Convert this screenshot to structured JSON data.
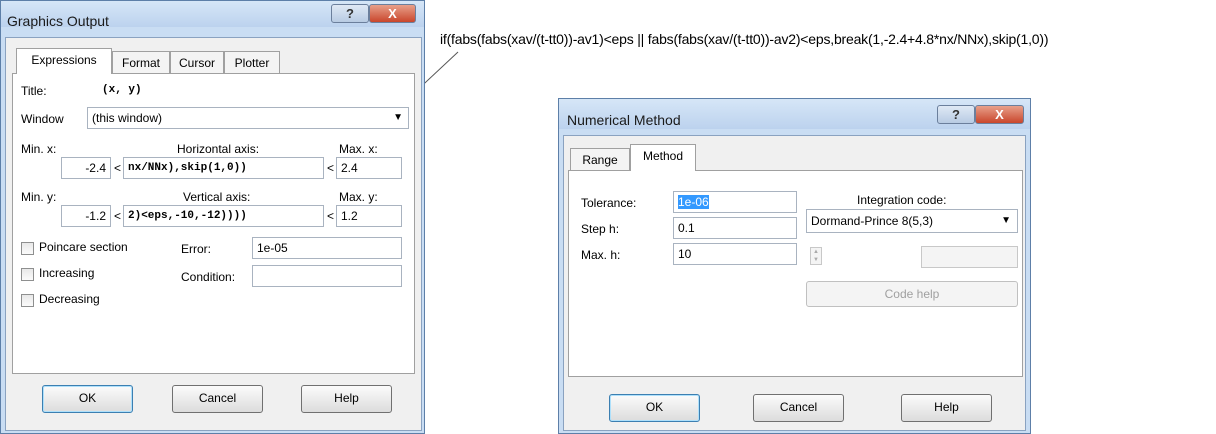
{
  "annotation": {
    "expression": "if(fabs(fabs(xav/(t-tt0))-av1)<eps || fabs(fabs(xav/(t-tt0))-av2)<eps,break(1,-2.4+4.8*nx/NNx),skip(1,0))"
  },
  "graphics": {
    "title": "Graphics Output",
    "help_btn": "?",
    "close_btn": "X",
    "tabs": [
      "Expressions",
      "Format",
      "Cursor",
      "Plotter"
    ],
    "title_label": "Title:",
    "title_value": "(x, y)",
    "window_label": "Window",
    "window_value": "(this window)",
    "min_x_label": "Min. x:",
    "horiz_label": "Horizontal axis:",
    "max_x_label": "Max. x:",
    "min_x_value": "-2.4",
    "horiz_value": "nx/NNx),skip(1,0))",
    "max_x_value": "2.4",
    "min_y_label": "Min. y:",
    "vert_label": "Vertical axis:",
    "max_y_label": "Max. y:",
    "min_y_value": "-1.2",
    "vert_value": "2)<eps,-10,-12))))",
    "max_y_value": "1.2",
    "lt": "<",
    "poincare_label": "Poincare section",
    "increasing_label": "Increasing",
    "decreasing_label": "Decreasing",
    "error_label": "Error:",
    "error_value": "1e-05",
    "condition_label": "Condition:",
    "condition_value": "",
    "ok": "OK",
    "cancel": "Cancel",
    "help": "Help"
  },
  "numerical": {
    "title": "Numerical Method",
    "help_btn": "?",
    "close_btn": "X",
    "tabs": [
      "Range",
      "Method"
    ],
    "tolerance_label": "Tolerance:",
    "tolerance_value": "1e-06",
    "step_label": "Step h:",
    "step_value": "0.1",
    "maxh_label": "Max. h:",
    "maxh_value": "10",
    "integration_label": "Integration code:",
    "integration_value": "Dormand-Prince 8(5,3)",
    "code_help": "Code help",
    "ok": "OK",
    "cancel": "Cancel",
    "help": "Help"
  }
}
